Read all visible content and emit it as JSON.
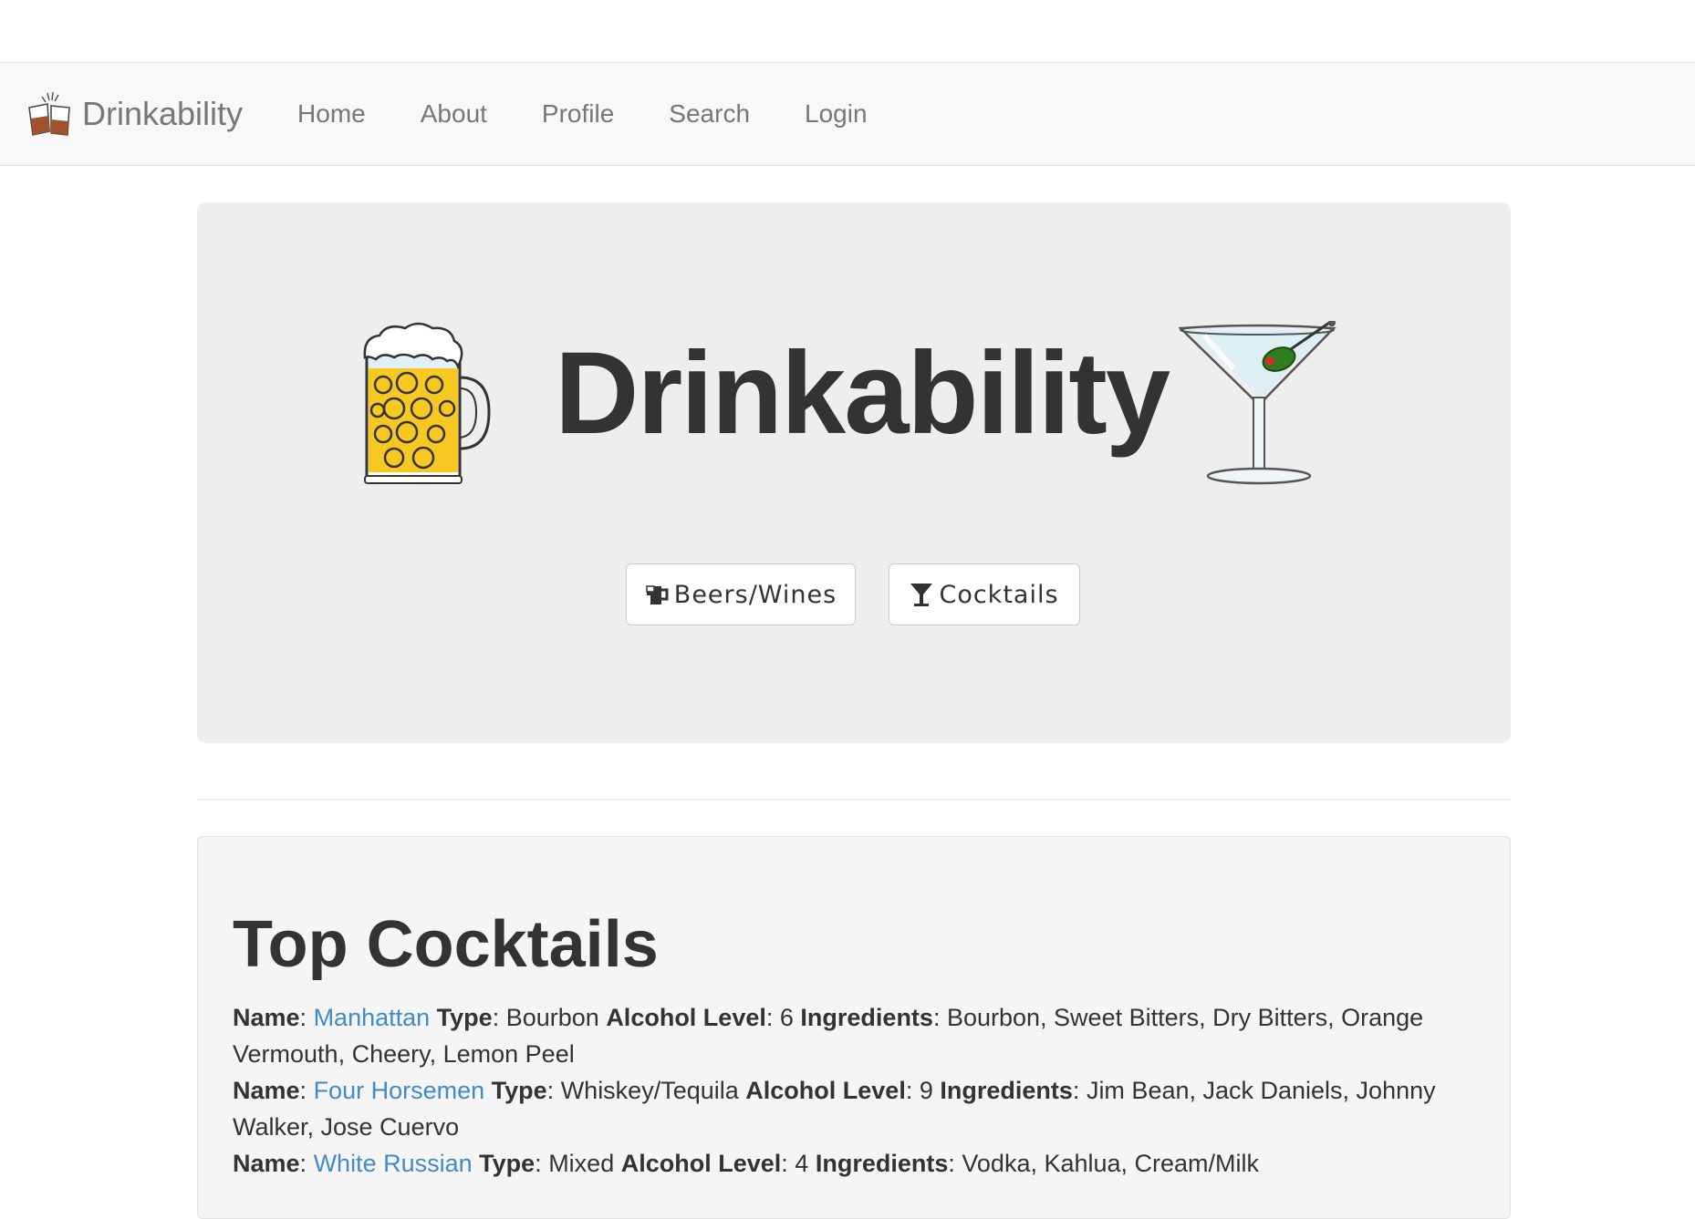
{
  "navbar": {
    "brand": "Drinkability",
    "links": [
      "Home",
      "About",
      "Profile",
      "Search",
      "Login"
    ]
  },
  "hero": {
    "title": "Drinkability",
    "buttons": {
      "beers": "Beers/Wines",
      "cocktails": "Cocktails"
    }
  },
  "top_cocktails": {
    "title": "Top Cocktails",
    "labels": {
      "name": "Name",
      "type": "Type",
      "alcohol_level": "Alcohol Level",
      "ingredients": "Ingredients"
    },
    "drinks": [
      {
        "name": "Manhattan",
        "type": "Bourbon",
        "alcohol_level": "6",
        "ingredients": "Bourbon, Sweet Bitters, Dry Bitters, Orange Vermouth, Cheery, Lemon Peel"
      },
      {
        "name": "Four Horsemen",
        "type": "Whiskey/Tequila",
        "alcohol_level": "9",
        "ingredients": "Jim Bean, Jack Daniels, Johnny Walker, Jose Cuervo"
      },
      {
        "name": "White Russian",
        "type": "Mixed",
        "alcohol_level": "4",
        "ingredients": "Vodka, Kahlua, Cream/Milk"
      }
    ]
  },
  "colors": {
    "navbar_bg": "#f8f8f8",
    "jumbotron_bg": "#eeeeee",
    "well_bg": "#f5f5f5",
    "link": "#428bca",
    "text": "#333333",
    "nav_text": "#777777"
  },
  "icons": {
    "brand": "toasting-glasses-icon",
    "beer": "beer-mug-icon",
    "martini": "martini-glass-icon",
    "beers_button": "mug-icon",
    "cocktails_button": "glass-icon"
  }
}
